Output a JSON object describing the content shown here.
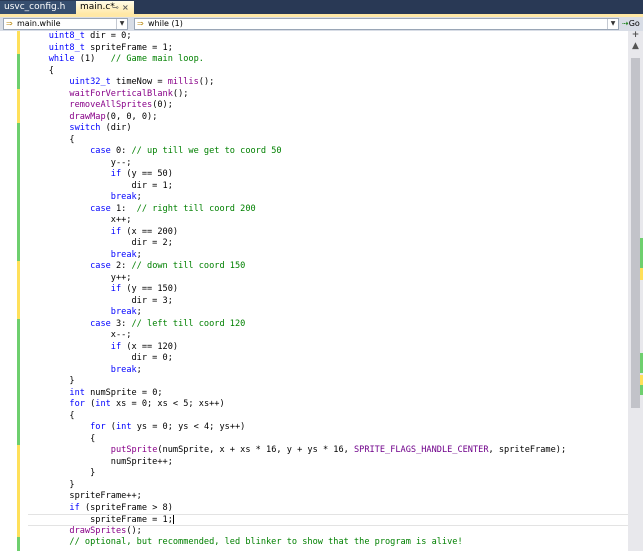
{
  "tabs": [
    {
      "label": "usvc_config.h",
      "active": false
    },
    {
      "label": "main.c*",
      "active": true,
      "pin_glyph": "⊸",
      "close_glyph": "×"
    }
  ],
  "navbar": {
    "scope_combo": "main.while",
    "member_combo": "while (1)",
    "go_label": "Go",
    "go_icon": "⇢"
  },
  "scrollbar": {
    "split_glyph": "+",
    "up_glyph": "▲"
  },
  "colors": {
    "keyword": "#0000ff",
    "function": "#880088",
    "macro": "#6f008a",
    "comment": "#008000",
    "saved_change": "#6ecf6e",
    "unsaved_change": "#ffe05a"
  },
  "code": {
    "lines": [
      "    uint8_t dir = 0;",
      "    uint8_t spriteFrame = 1;",
      "    while (1)   // Game main loop.",
      "    {",
      "        uint32_t timeNow = millis();",
      "        waitForVerticalBlank();",
      "        removeAllSprites(0);",
      "        drawMap(0, 0, 0);",
      "        switch (dir)",
      "        {",
      "            case 0: // up till we get to coord 50",
      "                y--;",
      "                if (y == 50)",
      "                    dir = 1;",
      "                break;",
      "            case 1:  // right till coord 200",
      "                x++;",
      "                if (x == 200)",
      "                    dir = 2;",
      "                break;",
      "            case 2: // down till coord 150",
      "                y++;",
      "                if (y == 150)",
      "                    dir = 3;",
      "                break;",
      "            case 3: // left till coord 120",
      "                x--;",
      "                if (x == 120)",
      "                    dir = 0;",
      "                break;",
      "        }",
      "        int numSprite = 0;",
      "        for (int xs = 0; xs < 5; xs++)",
      "        {",
      "            for (int ys = 0; ys < 4; ys++)",
      "            {",
      "                putSprite(numSprite, x + xs * 16, y + ys * 16, SPRITE_FLAGS_HANDLE_CENTER, spriteFrame);",
      "                numSprite++;",
      "            }",
      "        }",
      "        spriteFrame++;",
      "        if (spriteFrame > 8)",
      "            spriteFrame = 1;",
      "        drawSprites();",
      "        // optional, but recommended, led blinker to show that the program is alive!"
    ],
    "current_line_index": 42,
    "unsaved_line_indices": [
      0,
      1,
      5,
      6,
      7,
      20,
      21,
      22,
      23,
      24,
      36,
      37,
      38,
      39,
      40,
      41,
      42,
      43
    ]
  }
}
